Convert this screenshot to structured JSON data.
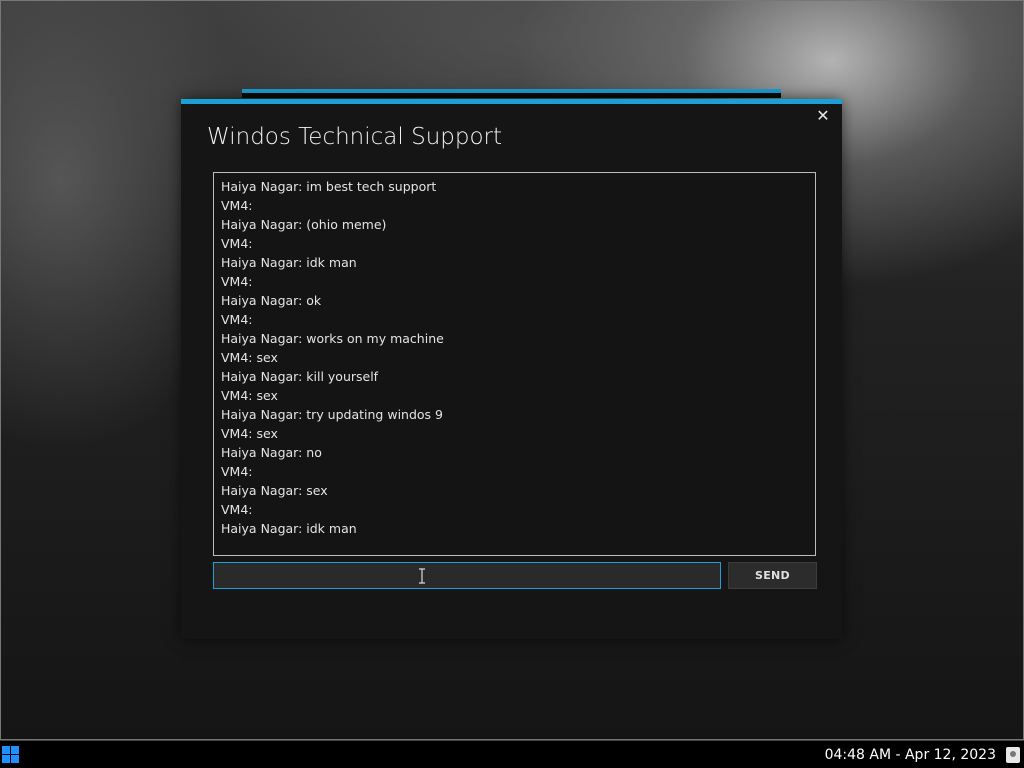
{
  "window": {
    "title": "Windos Technical Support",
    "close_symbol": "✕"
  },
  "chat": {
    "lines": [
      "Haiya Nagar: im best tech support",
      "VM4:",
      "Haiya Nagar: (ohio meme)",
      "VM4:",
      "Haiya Nagar: idk man",
      "VM4:",
      "Haiya Nagar: ok",
      "VM4:",
      "Haiya Nagar: works on my machine",
      "VM4: sex",
      "Haiya Nagar: kill yourself",
      "VM4: sex",
      "Haiya Nagar: try updating windos 9",
      "VM4: sex",
      "Haiya Nagar: no",
      "VM4:",
      "Haiya Nagar: sex",
      "VM4:",
      "Haiya Nagar: idk man"
    ]
  },
  "input": {
    "value": "",
    "placeholder": ""
  },
  "send_button": {
    "label": "SEND"
  },
  "taskbar": {
    "clock": "04:48 AM - Apr 12, 2023",
    "start_icon": "windows-logo-icon",
    "tray_icon": "notification-icon"
  },
  "colors": {
    "accent": "#1aa0d6",
    "window_bg": "#151515",
    "text": "#e4e4e4"
  }
}
